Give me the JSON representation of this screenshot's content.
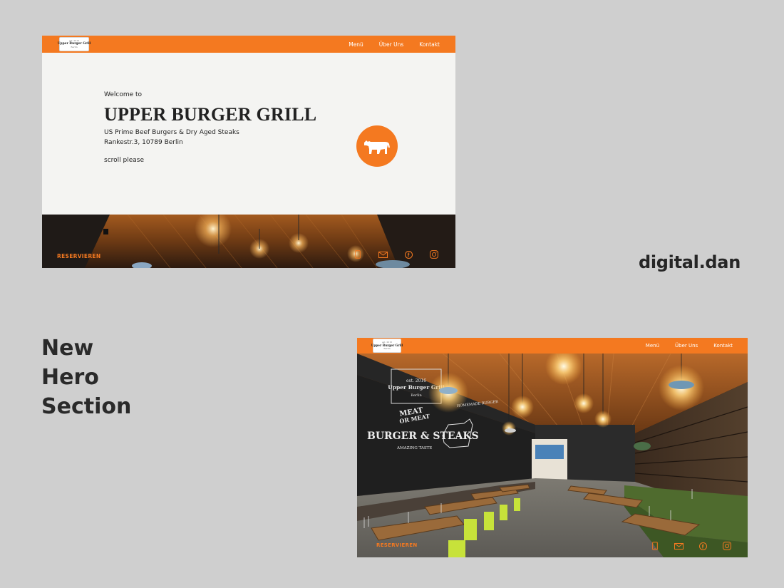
{
  "brand": {
    "name": "digital.dan"
  },
  "section_title": {
    "lines": [
      "New",
      "Hero",
      "Section"
    ]
  },
  "colors": {
    "accent": "#f47920",
    "page_bg": "#cfcfcf",
    "hero_bg": "#f4f4f2",
    "text_dark": "#222222"
  },
  "logo": {
    "sup": "est. 2016",
    "name": "Upper Burger Grill",
    "sub": "Berlin"
  },
  "nav": {
    "links": [
      "Menü",
      "Über Uns",
      "Kontakt"
    ]
  },
  "hero": {
    "welcome": "Welcome to",
    "title": "UPPER BURGER GRILL",
    "tagline": "US Prime Beef Burgers & Dry Aged Steaks",
    "address": "Rankestr.3, 10789 Berlin",
    "scroll_hint": "scroll please"
  },
  "cta": {
    "reserve": "RESERVIEREN"
  },
  "social_icons": [
    "phone-icon",
    "mail-icon",
    "facebook-icon",
    "instagram-icon"
  ],
  "chalkboard": {
    "meat": "MEAT",
    "or_meat": "OR MEAT",
    "burger_steaks": "BURGER & STEAKS",
    "amazing_taste": "AMAZING TASTE",
    "homemade": "HOMEMADE BURGER"
  }
}
